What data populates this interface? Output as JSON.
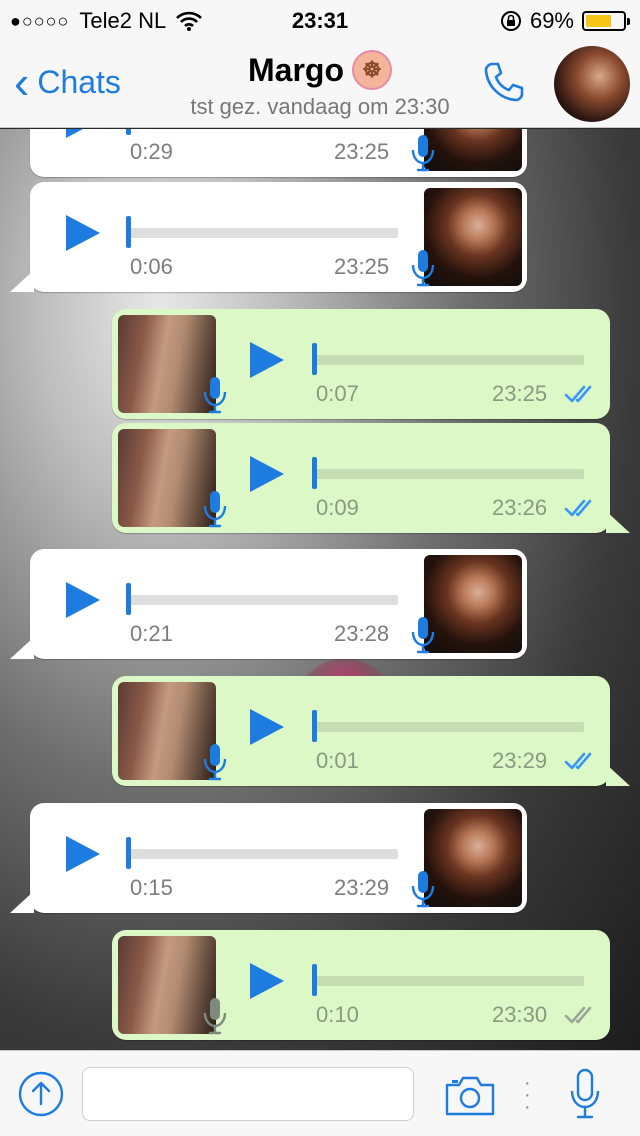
{
  "status_bar": {
    "signal": "●○○○○",
    "carrier": "Tele2 NL",
    "time": "23:31",
    "battery_percent_label": "69%",
    "battery_level": 0.69
  },
  "header": {
    "back_label": "Chats",
    "contact_name": "Margo",
    "status": "tst gez. vandaag om 23:30"
  },
  "messages": [
    {
      "direction": "in",
      "duration": "0:29",
      "time": "23:25"
    },
    {
      "direction": "in",
      "duration": "0:06",
      "time": "23:25"
    },
    {
      "direction": "out",
      "duration": "0:07",
      "time": "23:25",
      "read": true
    },
    {
      "direction": "out",
      "duration": "0:09",
      "time": "23:26",
      "read": true
    },
    {
      "direction": "in",
      "duration": "0:21",
      "time": "23:28"
    },
    {
      "direction": "out",
      "duration": "0:01",
      "time": "23:29",
      "read": true
    },
    {
      "direction": "in",
      "duration": "0:15",
      "time": "23:29"
    },
    {
      "direction": "out",
      "duration": "0:10",
      "time": "23:30",
      "read": false
    }
  ],
  "input": {
    "placeholder": ""
  },
  "colors": {
    "accent": "#1e7be0",
    "outgoing_bubble": "#dcf8c6",
    "incoming_bubble": "#ffffff",
    "read_ticks": "#3497f9",
    "unread_ticks": "#9aa59a"
  },
  "icons": [
    "wifi-icon",
    "orientation-lock-icon",
    "battery-icon",
    "chevron-left-icon",
    "phone-icon",
    "play-icon",
    "microphone-icon",
    "double-check-icon",
    "share-icon",
    "camera-icon"
  ]
}
